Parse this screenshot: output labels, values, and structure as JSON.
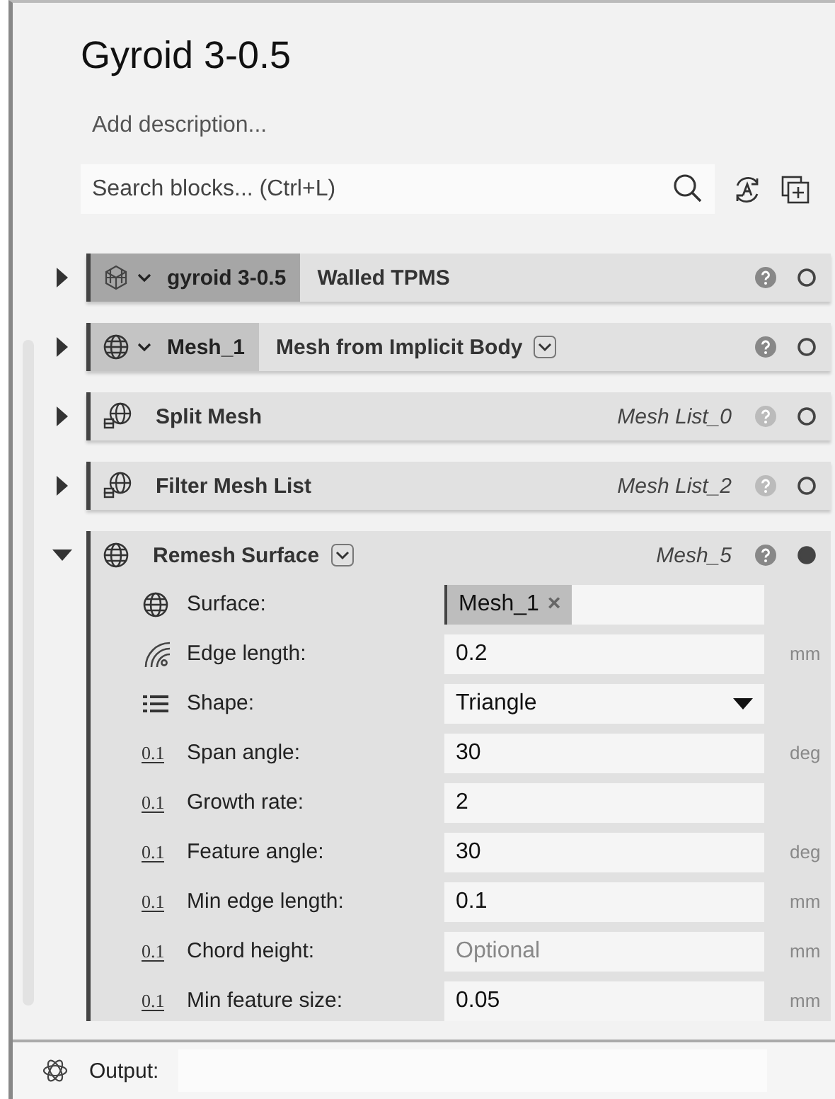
{
  "title": "Gyroid 3-0.5",
  "description": {
    "placeholder": "Add description..."
  },
  "search": {
    "placeholder": "Search blocks... (Ctrl+L)"
  },
  "blocks": [
    {
      "kind": "variable",
      "expanded": false,
      "variable": "gyroid 3-0.5",
      "title": "Walled TPMS",
      "has_menu": false,
      "help_enabled": true,
      "computed": false
    },
    {
      "kind": "variable",
      "expanded": false,
      "variable": "Mesh_1",
      "title": "Mesh from Implicit Body",
      "has_menu": true,
      "help_enabled": true,
      "computed": false
    },
    {
      "kind": "operation",
      "expanded": false,
      "title": "Split Mesh",
      "output": "Mesh List_0",
      "has_menu": false,
      "help_enabled": false,
      "computed": false
    },
    {
      "kind": "operation",
      "expanded": false,
      "title": "Filter Mesh List",
      "output": "Mesh List_2",
      "has_menu": false,
      "help_enabled": false,
      "computed": false
    },
    {
      "kind": "operation",
      "expanded": true,
      "title": "Remesh Surface",
      "output": "Mesh_5",
      "has_menu": true,
      "help_enabled": true,
      "computed": true,
      "params": [
        {
          "kind": "mesh",
          "label": "Surface:",
          "chip": "Mesh_1",
          "chip_remove": "×"
        },
        {
          "kind": "length",
          "label": "Edge length:",
          "value": "0.2",
          "unit": "mm"
        },
        {
          "kind": "list",
          "label": "Shape:",
          "value": "Triangle"
        },
        {
          "kind": "number",
          "icon_label": "0.1",
          "label": "Span angle:",
          "value": "30",
          "unit": "deg"
        },
        {
          "kind": "number",
          "icon_label": "0.1",
          "label": "Growth rate:",
          "value": "2"
        },
        {
          "kind": "number",
          "icon_label": "0.1",
          "label": "Feature angle:",
          "value": "30",
          "unit": "deg"
        },
        {
          "kind": "number",
          "icon_label": "0.1",
          "label": "Min edge length:",
          "value": "0.1",
          "unit": "mm"
        },
        {
          "kind": "number",
          "icon_label": "0.1",
          "label": "Chord height:",
          "placeholder": "Optional",
          "unit": "mm"
        },
        {
          "kind": "number",
          "icon_label": "0.1",
          "label": "Min feature size:",
          "value": "0.05",
          "unit": "mm"
        }
      ]
    }
  ],
  "output": {
    "label": "Output:"
  }
}
